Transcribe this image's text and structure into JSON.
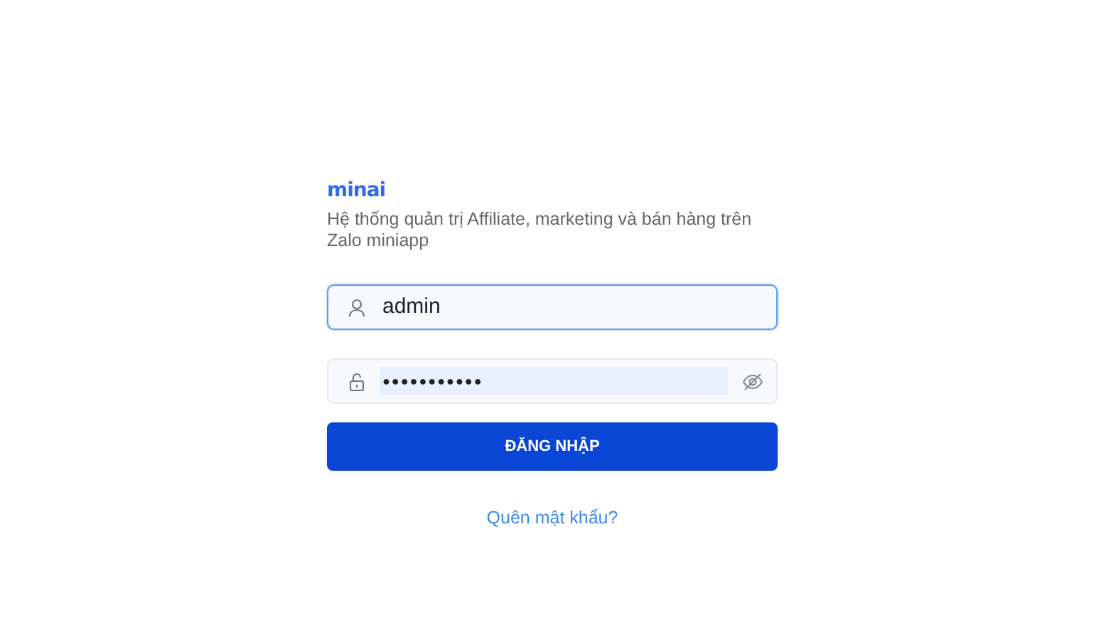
{
  "logo": "minai",
  "subtitle": "Hệ thống quản trị Affiliate, marketing và bán hàng trên Zalo miniapp",
  "username": {
    "value": "admin",
    "focused": true
  },
  "password": {
    "value": "●●●●●●●●●●●",
    "focused": false,
    "autofilled": true
  },
  "login_button": "ĐĂNG NHẬP",
  "forgot_link": "Quên mật khẩu?"
}
